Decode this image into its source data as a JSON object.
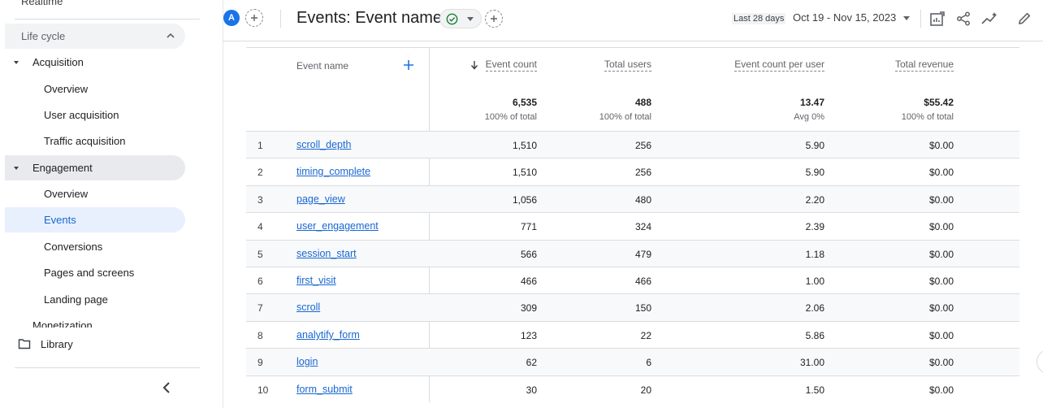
{
  "sidebar": {
    "realtime": "Realtime",
    "lifecycle": "Life cycle",
    "acquisition": "Acquisition",
    "acquisition_items": [
      "Overview",
      "User acquisition",
      "Traffic acquisition"
    ],
    "engagement": "Engagement",
    "engagement_items": [
      "Overview",
      "Events",
      "Conversions",
      "Pages and screens",
      "Landing page"
    ],
    "monetization": "Monetization",
    "library": "Library"
  },
  "header": {
    "avatar": "A",
    "title": "Events: Event name",
    "date_hint": "Last 28 days",
    "date_range": "Oct 19 - Nov 15, 2023"
  },
  "table": {
    "columns": [
      "Event name",
      "Event count",
      "Total users",
      "Event count per user",
      "Total revenue"
    ],
    "totals": [
      {
        "value": "6,535",
        "sub": "100% of total"
      },
      {
        "value": "488",
        "sub": "100% of total"
      },
      {
        "value": "13.47",
        "sub": "Avg 0%"
      },
      {
        "value": "$55.42",
        "sub": "100% of total"
      }
    ],
    "rows": [
      {
        "idx": "1",
        "name": "scroll_depth",
        "count": "1,510",
        "users": "256",
        "per_user": "5.90",
        "revenue": "$0.00"
      },
      {
        "idx": "2",
        "name": "timing_complete",
        "count": "1,510",
        "users": "256",
        "per_user": "5.90",
        "revenue": "$0.00"
      },
      {
        "idx": "3",
        "name": "page_view",
        "count": "1,056",
        "users": "480",
        "per_user": "2.20",
        "revenue": "$0.00"
      },
      {
        "idx": "4",
        "name": "user_engagement",
        "count": "771",
        "users": "324",
        "per_user": "2.39",
        "revenue": "$0.00"
      },
      {
        "idx": "5",
        "name": "session_start",
        "count": "566",
        "users": "479",
        "per_user": "1.18",
        "revenue": "$0.00"
      },
      {
        "idx": "6",
        "name": "first_visit",
        "count": "466",
        "users": "466",
        "per_user": "1.00",
        "revenue": "$0.00"
      },
      {
        "idx": "7",
        "name": "scroll",
        "count": "309",
        "users": "150",
        "per_user": "2.06",
        "revenue": "$0.00"
      },
      {
        "idx": "8",
        "name": "analytify_form",
        "count": "123",
        "users": "22",
        "per_user": "5.86",
        "revenue": "$0.00"
      },
      {
        "idx": "9",
        "name": "login",
        "count": "62",
        "users": "6",
        "per_user": "31.00",
        "revenue": "$0.00"
      },
      {
        "idx": "10",
        "name": "form_submit",
        "count": "30",
        "users": "20",
        "per_user": "1.50",
        "revenue": "$0.00"
      }
    ]
  }
}
